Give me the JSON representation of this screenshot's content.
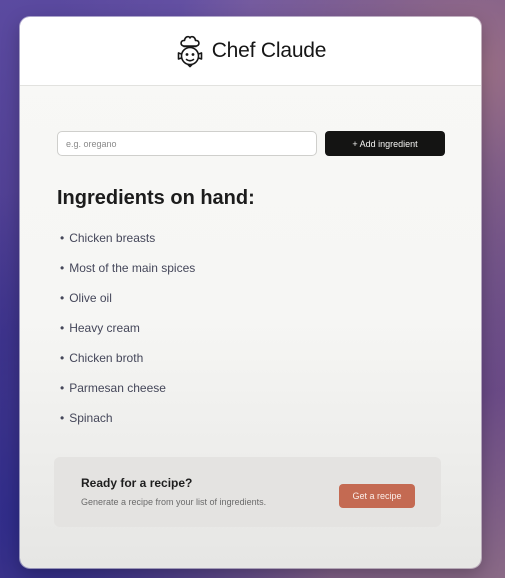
{
  "app": {
    "title": "Chef Claude",
    "logo_icon": "chef-face-icon"
  },
  "form": {
    "placeholder": "e.g. oregano",
    "value": "",
    "add_label": "+ Add ingredient"
  },
  "ingredients": {
    "heading": "Ingredients on hand:",
    "items": [
      "Chicken breasts",
      "Most of the main spices",
      "Olive oil",
      "Heavy cream",
      "Chicken broth",
      "Parmesan cheese",
      "Spinach"
    ]
  },
  "cta": {
    "title": "Ready for a recipe?",
    "subtitle": "Generate a recipe from your list of ingredients.",
    "button_label": "Get a recipe"
  },
  "colors": {
    "primary_button": "#141413",
    "accent_button": "#c46a52",
    "cta_background": "#e4e3e1"
  }
}
